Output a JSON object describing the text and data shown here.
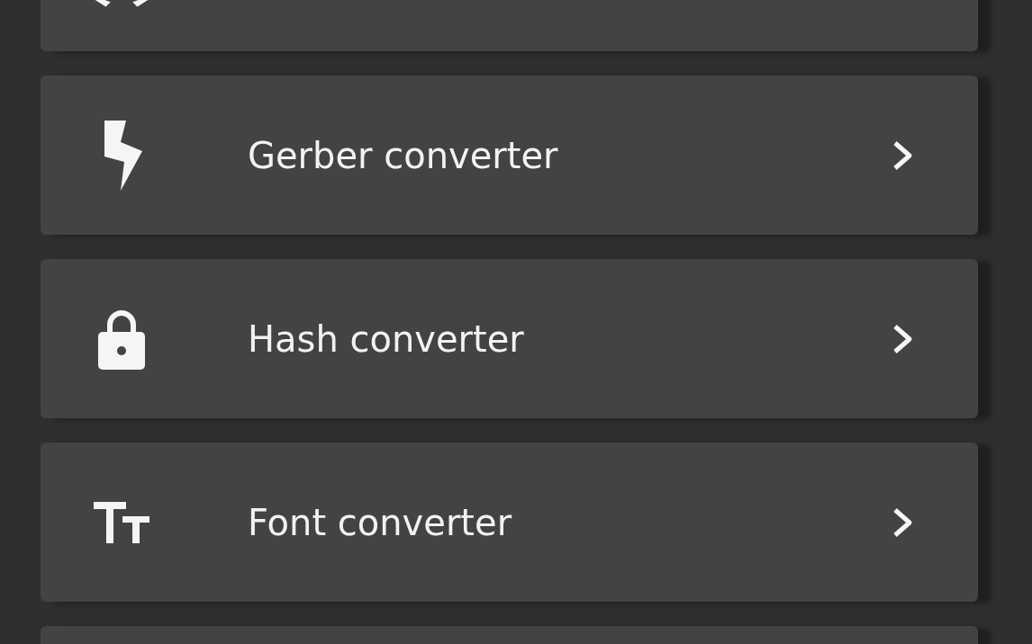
{
  "items": [
    {
      "label": "Gerber converter"
    },
    {
      "label": "Hash converter"
    },
    {
      "label": "Font converter"
    }
  ]
}
